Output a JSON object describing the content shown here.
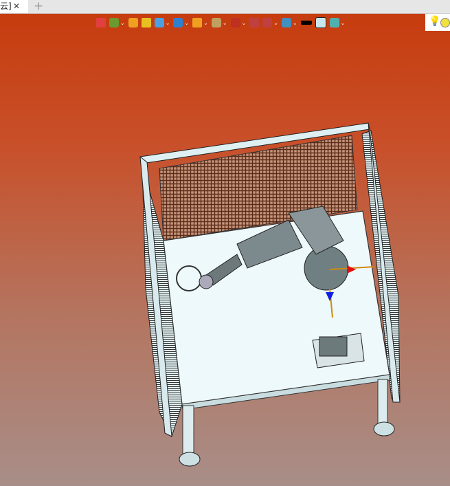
{
  "tab": {
    "label": "云]",
    "close": "✕",
    "new_tab": "+"
  },
  "toolbar": {
    "items": [
      {
        "icon": "exit-icon",
        "dropdown": false,
        "color": "#e04040"
      },
      {
        "icon": "assembly-icon",
        "dropdown": true,
        "color": "#6a9a30"
      },
      {
        "icon": "pencil-icon",
        "dropdown": false,
        "color": "#f0a020"
      },
      {
        "icon": "box-yellow-icon",
        "dropdown": false,
        "color": "#e8c020"
      },
      {
        "icon": "cube-icon",
        "dropdown": true,
        "color": "#4aa0e0"
      },
      {
        "icon": "view-orient-icon",
        "dropdown": true,
        "color": "#3080d0"
      },
      {
        "icon": "section-icon",
        "dropdown": true,
        "color": "#f0a020"
      },
      {
        "icon": "zoom-icon",
        "dropdown": true,
        "color": "#c0a060"
      },
      {
        "icon": "target-icon",
        "dropdown": true,
        "color": "#c03020"
      },
      {
        "icon": "measure-icon",
        "dropdown": false,
        "color": "#c04040"
      },
      {
        "icon": "dimension-icon",
        "dropdown": true,
        "color": "#c04040"
      },
      {
        "icon": "display-icon",
        "dropdown": true,
        "color": "#4090c0"
      },
      {
        "icon": "black-rect-icon",
        "dropdown": false,
        "color": "#000000"
      },
      {
        "icon": "background-color-icon",
        "dropdown": false,
        "color": "#c8e8f0"
      },
      {
        "icon": "layer-icon",
        "dropdown": true,
        "color": "#50b0b0"
      }
    ]
  },
  "lights": [
    {
      "icon": "bulb-icon"
    },
    {
      "icon": "light-yellow-icon",
      "color": "#f0e040"
    }
  ]
}
